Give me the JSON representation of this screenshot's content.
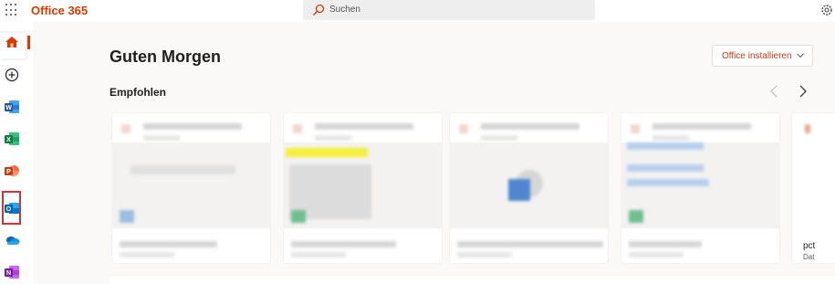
{
  "app": {
    "brand": "Office 365"
  },
  "search": {
    "placeholder": "Suchen"
  },
  "main": {
    "greeting": "Guten Morgen",
    "install_button": "Office installieren",
    "section_title": "Empfohlen"
  },
  "partial_card": {
    "name": "pct",
    "sub": "Dat"
  },
  "colors": {
    "brand": "#d83b01",
    "word": "#2b579a",
    "excel": "#217346",
    "powerpoint": "#d24726",
    "outlook": "#0078d4",
    "onedrive": "#0364b8",
    "onenote": "#7719aa",
    "highlight": "#d13438"
  },
  "icons": [
    "waffle-icon",
    "search-icon",
    "settings-gear-icon",
    "home-icon",
    "create-plus-icon",
    "word-icon",
    "excel-icon",
    "powerpoint-icon",
    "outlook-icon",
    "onedrive-icon",
    "onenote-icon",
    "chevron-down-icon",
    "chevron-left-icon",
    "chevron-right-icon"
  ]
}
